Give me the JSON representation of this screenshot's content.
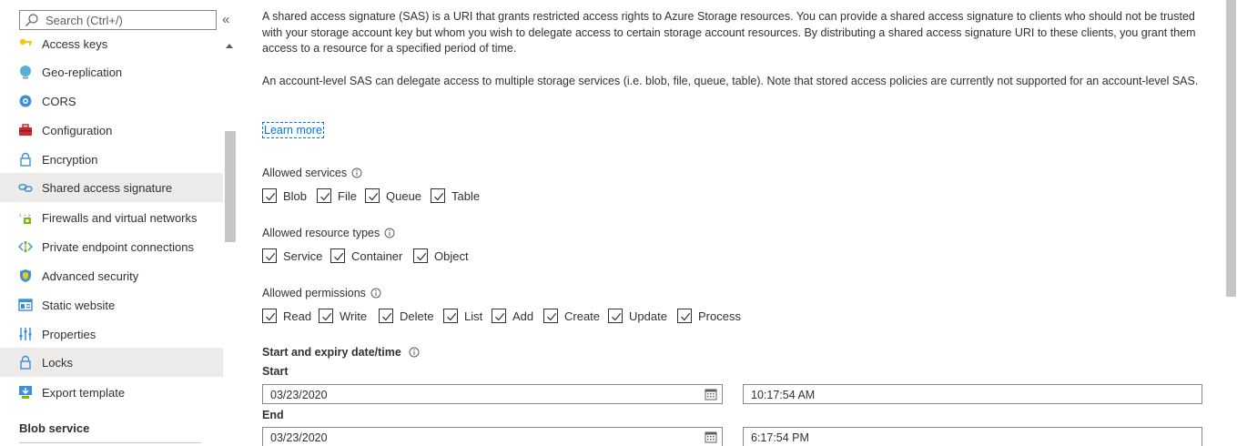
{
  "sidebar": {
    "search": {
      "placeholder": "Search (Ctrl+/)"
    },
    "collapse_glyph": "«",
    "items": [
      {
        "label": "Access keys",
        "icon": "key-icon"
      },
      {
        "label": "Geo-replication",
        "icon": "globe-icon"
      },
      {
        "label": "CORS",
        "icon": "cors-icon"
      },
      {
        "label": "Configuration",
        "icon": "toolbox-icon"
      },
      {
        "label": "Encryption",
        "icon": "lock-icon"
      },
      {
        "label": "Shared access signature",
        "icon": "link-icon",
        "active": true
      },
      {
        "label": "Firewalls and virtual networks",
        "icon": "firewall-icon"
      },
      {
        "label": "Private endpoint connections",
        "icon": "endpoint-icon"
      },
      {
        "label": "Advanced security",
        "icon": "shield-icon"
      },
      {
        "label": "Static website",
        "icon": "website-icon"
      },
      {
        "label": "Properties",
        "icon": "properties-icon"
      },
      {
        "label": "Locks",
        "icon": "lock-icon",
        "active": true
      },
      {
        "label": "Export template",
        "icon": "export-icon"
      }
    ],
    "section_header": "Blob service"
  },
  "main": {
    "intro": "A shared access signature (SAS) is a URI that grants restricted access rights to Azure Storage resources. You can provide a shared access signature to clients who should not be trusted with your storage account key but whom you wish to delegate access to certain storage account resources. By distributing a shared access signature URI to these clients, you grant them access to a resource for a specified period of time.",
    "account_sas_note": "An account-level SAS can delegate access to multiple storage services (i.e. blob, file, queue, table). Note that stored access policies are currently not supported for an account-level SAS.",
    "learn_more": "Learn more",
    "allowed_services": {
      "label": "Allowed services",
      "options": [
        {
          "label": "Blob",
          "checked": true
        },
        {
          "label": "File",
          "checked": true
        },
        {
          "label": "Queue",
          "checked": true
        },
        {
          "label": "Table",
          "checked": true
        }
      ]
    },
    "allowed_resource_types": {
      "label": "Allowed resource types",
      "options": [
        {
          "label": "Service",
          "checked": true
        },
        {
          "label": "Container",
          "checked": true
        },
        {
          "label": "Object",
          "checked": true
        }
      ]
    },
    "allowed_permissions": {
      "label": "Allowed permissions",
      "options": [
        {
          "label": "Read",
          "checked": true
        },
        {
          "label": "Write",
          "checked": true
        },
        {
          "label": "Delete",
          "checked": true
        },
        {
          "label": "List",
          "checked": true
        },
        {
          "label": "Add",
          "checked": true
        },
        {
          "label": "Create",
          "checked": true
        },
        {
          "label": "Update",
          "checked": true
        },
        {
          "label": "Process",
          "checked": true
        }
      ]
    },
    "datetime": {
      "label": "Start and expiry date/time",
      "start_label": "Start",
      "start_date": "03/23/2020",
      "start_time": "10:17:54 AM",
      "end_label": "End",
      "end_date": "03/23/2020",
      "end_time": "6:17:54 PM"
    }
  },
  "colors": {
    "accent": "#0078d4",
    "text": "#323130",
    "active_bg": "#edebe9",
    "border": "#8a8886"
  }
}
